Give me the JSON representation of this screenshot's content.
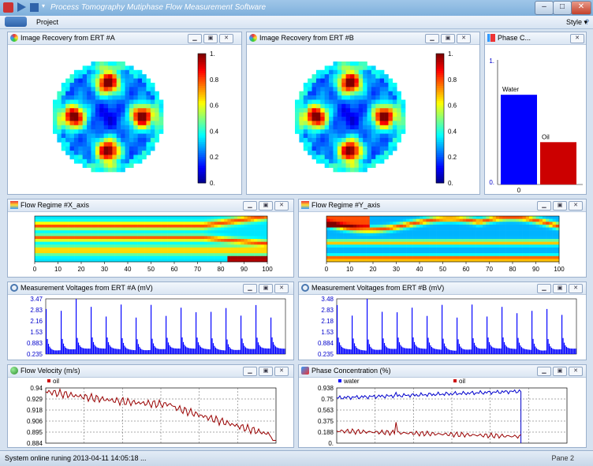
{
  "window": {
    "title": "Process Tomography Mutiphase Flow Measurement Software"
  },
  "ribbon": {
    "menus": [
      "Project"
    ],
    "style_label": "Style"
  },
  "panels": {
    "ert_a_image": {
      "title": "Image Recovery from ERT #A"
    },
    "ert_b_image": {
      "title": "Image Recovery from ERT #B"
    },
    "phase_c": {
      "title": "Phase C..."
    },
    "flow_regime_x": {
      "title": "Flow Regime #X_axis"
    },
    "flow_regime_y": {
      "title": "Flow Regime #Y_axis"
    },
    "volt_a": {
      "title": "Measurement Voltages from ERT #A (mV)"
    },
    "volt_b": {
      "title": "Measurement Voltages from ERT #B (mV)"
    },
    "velocity": {
      "title": "Flow Velocity (m/s)"
    },
    "concentration": {
      "title": "Phase Concentration (%)"
    }
  },
  "chart_data": [
    {
      "id": "colorbar_a",
      "type": "heatmap",
      "tick_labels": [
        "1.",
        "0.8",
        "0.6",
        "0.4",
        "0.2",
        "0."
      ]
    },
    {
      "id": "colorbar_b",
      "type": "heatmap",
      "tick_labels": [
        "1.",
        "0.8",
        "0.6",
        "0.4",
        "0.2",
        "0."
      ]
    },
    {
      "id": "phase_bar",
      "type": "bar",
      "categories": [
        "0"
      ],
      "series": [
        {
          "name": "Water",
          "values": [
            0.72
          ]
        },
        {
          "name": "Oil",
          "values": [
            0.34
          ]
        }
      ],
      "yticks": [
        "1.",
        "0."
      ],
      "ylim": [
        0,
        1
      ]
    },
    {
      "id": "regime_x",
      "type": "heatmap",
      "xticks": [
        "0",
        "10",
        "20",
        "30",
        "40",
        "50",
        "60",
        "70",
        "80",
        "90",
        "100"
      ]
    },
    {
      "id": "regime_y",
      "type": "heatmap",
      "xticks": [
        "0",
        "10",
        "20",
        "30",
        "40",
        "50",
        "60",
        "70",
        "80",
        "90",
        "100"
      ]
    },
    {
      "id": "volt_a_chart",
      "type": "bar",
      "yticks": [
        "3.47",
        "2.83",
        "2.16",
        "1.53",
        "0.883",
        "0.235"
      ]
    },
    {
      "id": "volt_b_chart",
      "type": "bar",
      "yticks": [
        "3.48",
        "2.83",
        "2.18",
        "1.53",
        "0.884",
        "0.235"
      ]
    },
    {
      "id": "velocity_chart",
      "type": "line",
      "legend": [
        "oil"
      ],
      "yticks": [
        "0.94",
        "0.929",
        "0.918",
        "0.906",
        "0.895",
        "0.884"
      ]
    },
    {
      "id": "conc_chart",
      "type": "line",
      "legend": [
        "water",
        "oil"
      ],
      "yticks": [
        "0.938",
        "0.75",
        "0.563",
        "0.375",
        "0.188",
        "0."
      ]
    }
  ],
  "status": {
    "text": "System online runing 2013-04-11 14:05:18 ...",
    "pane": "Pane 2"
  },
  "colors": {
    "water": "#0000ff",
    "oil": "#cc0000",
    "accent": "#2f63aa"
  },
  "icons": {
    "panel_image": "palette-icon",
    "panel_phase": "chart-icon",
    "panel_regime": "regime-icon",
    "panel_volt": "magnifier-icon",
    "panel_vel": "globe-icon"
  }
}
